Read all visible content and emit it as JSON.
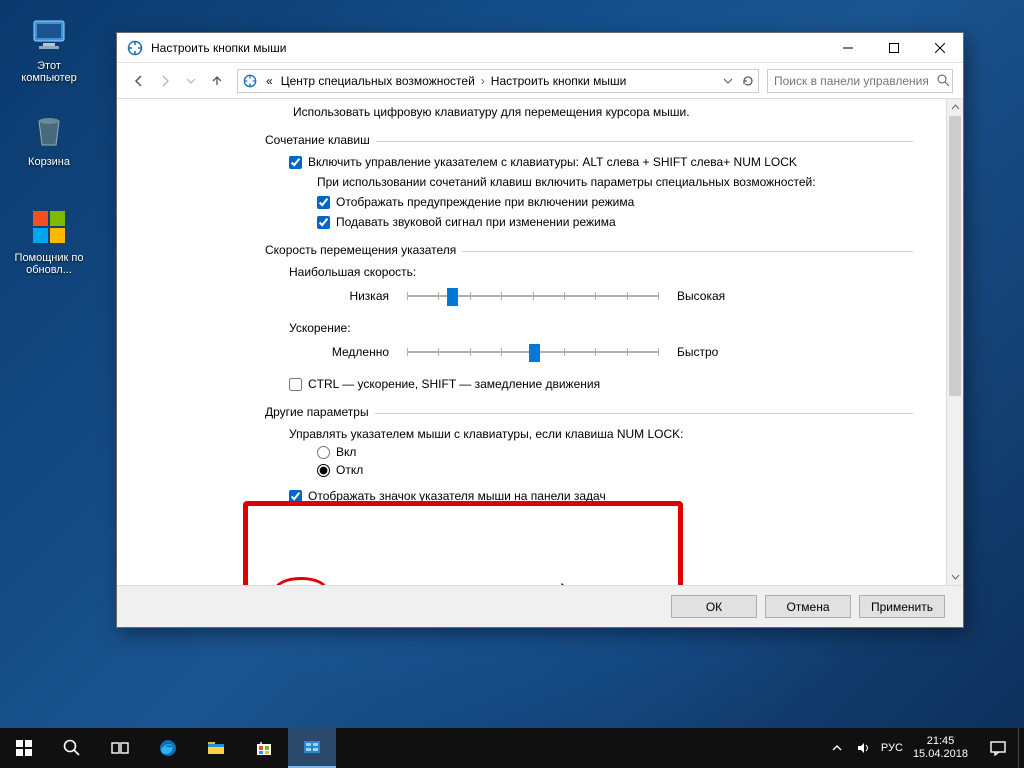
{
  "desktop": {
    "icons": {
      "computer": "Этот компьютер",
      "recycle": "Корзина",
      "helper": "Помощник по обновл..."
    }
  },
  "window": {
    "title": "Настроить кнопки мыши",
    "breadcrumbs": {
      "prefix": "«",
      "parent": "Центр специальных возможностей",
      "current": "Настроить кнопки мыши"
    },
    "search_placeholder": "Поиск в панели управления",
    "intro": "Использовать цифровую клавиатуру для перемещения курсора мыши.",
    "groups": {
      "shortcut": {
        "title": "Сочетание клавиш",
        "enable": "Включить управление указателем с клавиатуры: ALT слева + SHIFT слева+ NUM LOCK",
        "sub_intro": "При использовании сочетаний клавиш включить параметры специальных возможностей:",
        "warn": "Отображать предупреждение при включении режима",
        "sound": "Подавать звуковой сигнал при изменении режима"
      },
      "speed": {
        "title": "Скорость перемещения указателя",
        "max_label": "Наибольшая скорость:",
        "low": "Низкая",
        "high": "Высокая",
        "accel_label": "Ускорение:",
        "slow": "Медленно",
        "fast": "Быстро",
        "ctrl": "CTRL — ускорение, SHIFT — замедление движения"
      },
      "other": {
        "title": "Другие параметры",
        "numlock_label": "Управлять указателем мыши с клавиатуры, если клавиша NUM LOCK:",
        "on": "Вкл",
        "off": "Откл",
        "tray": "Отображать значок указателя мыши на панели задач"
      }
    },
    "buttons": {
      "ok": "ОК",
      "cancel": "Отмена",
      "apply": "Применить"
    }
  },
  "taskbar": {
    "lang": "РУС",
    "time": "21:45",
    "date": "15.04.2018"
  },
  "colors": {
    "accent": "#0078d7",
    "highlight": "#e10000"
  }
}
